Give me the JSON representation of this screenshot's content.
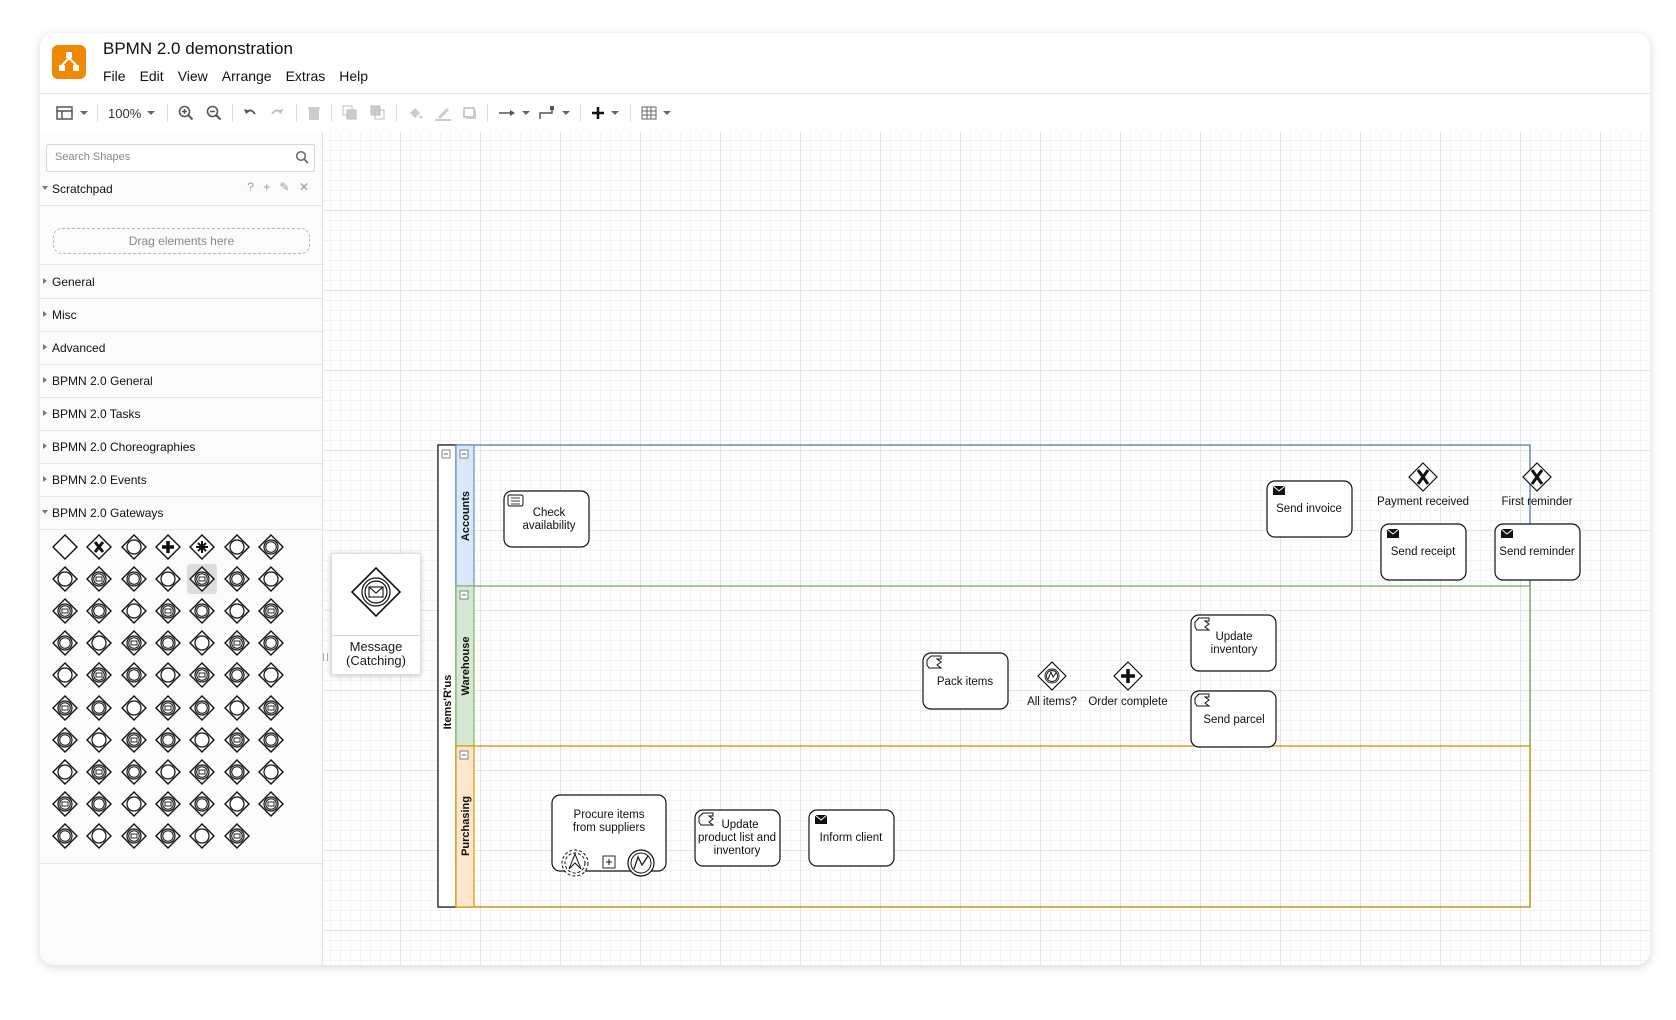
{
  "app": {
    "doc_title": "BPMN 2.0 demonstration",
    "menu": [
      "File",
      "Edit",
      "View",
      "Arrange",
      "Extras",
      "Help"
    ]
  },
  "toolbar": {
    "zoom": "100%"
  },
  "sidebar": {
    "search_placeholder": "Search Shapes",
    "scratchpad": {
      "label": "Scratchpad",
      "tools": "? + ✎ ✕",
      "drop_hint": "Drag elements here"
    },
    "sections": [
      "General",
      "Misc",
      "Advanced",
      "BPMN 2.0 General",
      "BPMN 2.0 Tasks",
      "BPMN 2.0 Choreographies",
      "BPMN 2.0 Events",
      "BPMN 2.0 Gateways"
    ],
    "gateways_count": 69,
    "gateways_selected_index": 11
  },
  "preview": {
    "caption_line1": "Message",
    "caption_line2": "(Catching)"
  },
  "diagram": {
    "pool": "Items'R'us",
    "lanes": [
      {
        "name": "Accounts",
        "color": "#6c8ebf",
        "fill": "#dae8fc"
      },
      {
        "name": "Warehouse",
        "color": "#82b366",
        "fill": "#d5e8d4"
      },
      {
        "name": "Purchasing",
        "color": "#d79b00",
        "fill": "#ffe6cc"
      }
    ],
    "tasks": {
      "check_availability": [
        "Check",
        "availability"
      ],
      "send_invoice": "Send invoice",
      "send_receipt": "Send receipt",
      "send_reminder": "Send reminder",
      "pack_items": "Pack items",
      "update_inventory": [
        "Update",
        "inventory"
      ],
      "send_parcel": "Send parcel",
      "procure_items": [
        "Procure items",
        "from suppliers"
      ],
      "update_product_list": [
        "Update",
        "product list and",
        "inventory"
      ],
      "inform_client": "Inform client"
    },
    "gateways": {
      "payment_received": "Payment received",
      "first_reminder": "First reminder",
      "all_items": "All items?",
      "order_complete": "Order complete"
    }
  }
}
